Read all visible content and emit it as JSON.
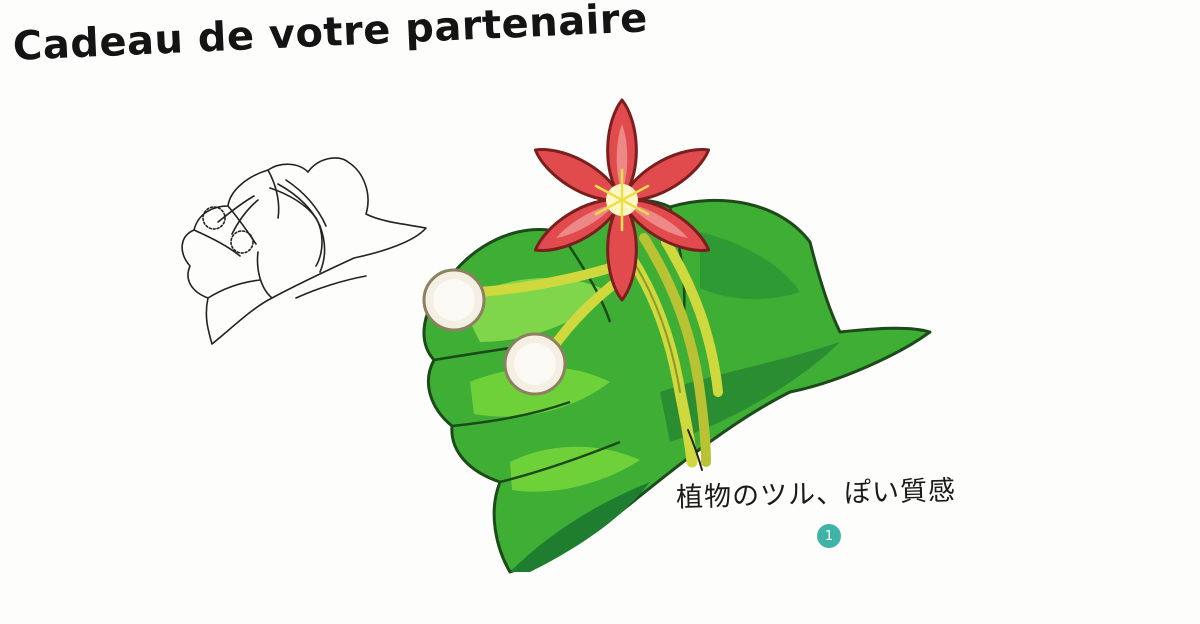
{
  "title": "Cadeau de votre partenaire",
  "annotation": {
    "text": "植物のツル、ぽい質感",
    "badge": "1"
  },
  "colors": {
    "background": "#fdfdfb",
    "leaf_light": "#6fd13a",
    "leaf_mid": "#3fae35",
    "leaf_dark": "#1e7d2f",
    "vine": "#cfd93e",
    "flower": "#e24b4d",
    "flower_center": "#fff6c8",
    "pompom": "#f3efe2",
    "badge": "#3fb3a6"
  },
  "icons": [
    "flower-icon",
    "pompom-icon",
    "leaf-icon"
  ]
}
